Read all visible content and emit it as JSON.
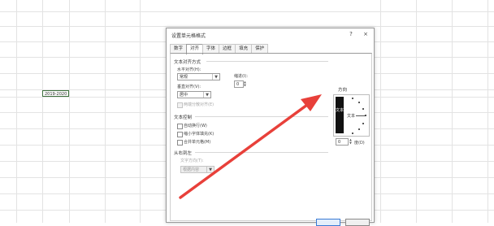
{
  "sheet": {
    "cell_text": "2019-2020"
  },
  "dialog": {
    "title": "设置单元格格式",
    "help_glyph": "?",
    "close_glyph": "×",
    "tabs": [
      "数字",
      "对齐",
      "字体",
      "边框",
      "填充",
      "保护"
    ],
    "active_tab": "对齐",
    "alignment_section": {
      "title": "文本对齐方式",
      "horizontal_label": "水平对齐(H):",
      "horizontal_value": "常规",
      "indent_label": "缩进(I):",
      "indent_value": "0",
      "vertical_label": "垂直对齐(V):",
      "vertical_value": "居中",
      "justify_distributed_label": "两端分散对齐(E)"
    },
    "text_control": {
      "title": "文本控制",
      "wrap_text": "自动换行(W)",
      "shrink_to_fit": "缩小字体填充(K)",
      "merge_cells": "合并单元格(M)"
    },
    "rtl": {
      "title": "从右到左",
      "direction_label": "文字方向(T):",
      "direction_value": "根据内容"
    },
    "orientation": {
      "title": "方向",
      "vertical_text": "文本",
      "horizontal_text": "文本",
      "degrees_value": "0",
      "degrees_label": "度(D)"
    }
  },
  "colors": {
    "arrow": "#e8403a"
  },
  "icons": {
    "dropdown": "chevron-down-icon",
    "spin_up": "spin-up-icon",
    "spin_down": "spin-down-icon"
  }
}
